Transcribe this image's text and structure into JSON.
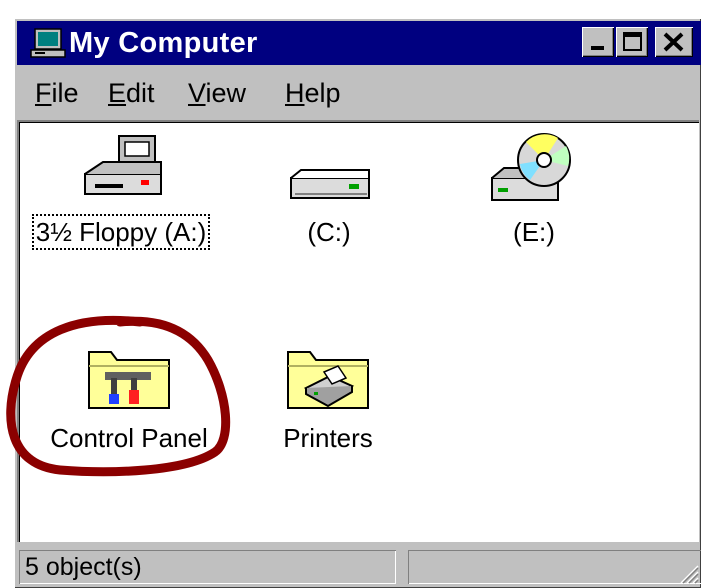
{
  "window": {
    "title": "My Computer",
    "title_icon": "computer-icon",
    "controls": {
      "minimize": "minimize-icon",
      "maximize": "maximize-icon",
      "close": "close-icon"
    }
  },
  "menubar": {
    "items": [
      {
        "first": "F",
        "rest": "ile"
      },
      {
        "first": "E",
        "rest": "dit"
      },
      {
        "first": "V",
        "rest": "iew"
      },
      {
        "first": "H",
        "rest": "elp"
      }
    ]
  },
  "content": {
    "items": [
      {
        "label": "3½ Floppy (A:)",
        "icon": "floppy-drive-icon",
        "focused": true
      },
      {
        "label": "(C:)",
        "icon": "hard-drive-icon"
      },
      {
        "label": "(E:)",
        "icon": "cd-drive-icon"
      },
      {
        "label": "Control Panel",
        "icon": "control-panel-folder-icon",
        "annotated": true
      },
      {
        "label": "Printers",
        "icon": "printers-folder-icon"
      }
    ]
  },
  "statusbar": {
    "object_count": "5 object(s)",
    "right_pane": ""
  },
  "colors": {
    "titlebar": "#000080",
    "face": "#c0c0c0",
    "annotation": "#8b0000"
  }
}
